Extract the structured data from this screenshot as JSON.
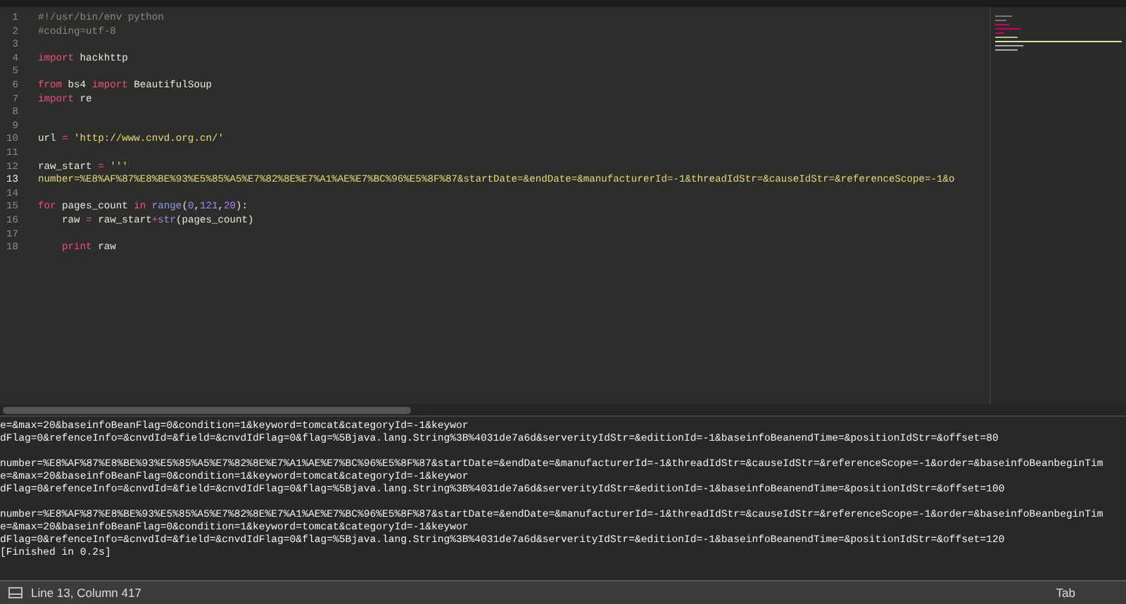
{
  "editor": {
    "lines": [
      {
        "number": "1",
        "current": false,
        "tokens": [
          {
            "kind": "comment",
            "text": "#!/usr/bin/env python"
          }
        ]
      },
      {
        "number": "2",
        "current": false,
        "tokens": [
          {
            "kind": "comment",
            "text": "#coding=utf-8"
          }
        ]
      },
      {
        "number": "3",
        "current": false
      },
      {
        "number": "4",
        "current": false,
        "tokens": [
          {
            "kind": "keyword",
            "text": "import"
          },
          {
            "kind": "plain",
            "text": " hackhttp"
          }
        ]
      },
      {
        "number": "5",
        "current": false
      },
      {
        "number": "6",
        "current": false,
        "tokens": [
          {
            "kind": "keyword",
            "text": "from"
          },
          {
            "kind": "plain",
            "text": " bs4 "
          },
          {
            "kind": "keyword",
            "text": "import"
          },
          {
            "kind": "plain",
            "text": " BeautifulSoup"
          }
        ]
      },
      {
        "number": "7",
        "current": false,
        "tokens": [
          {
            "kind": "keyword",
            "text": "import"
          },
          {
            "kind": "plain",
            "text": " re"
          }
        ]
      },
      {
        "number": "8",
        "current": false
      },
      {
        "number": "9",
        "current": false
      },
      {
        "number": "10",
        "current": false,
        "tokens": [
          {
            "kind": "plain",
            "text": "url "
          },
          {
            "kind": "keyword",
            "text": "="
          },
          {
            "kind": "string",
            "text": " 'http://www.cnvd.org.cn/'"
          }
        ]
      },
      {
        "number": "11",
        "current": false
      },
      {
        "number": "12",
        "current": false,
        "tokens": [
          {
            "kind": "plain",
            "text": "raw_start "
          },
          {
            "kind": "keyword",
            "text": "="
          },
          {
            "kind": "string",
            "text": " '''"
          }
        ]
      },
      {
        "number": "13",
        "current": true,
        "tokens": [
          {
            "kind": "string",
            "text": "number=%E8%AF%87%E8%BE%93%E5%85%A5%E7%82%8E%E7%A1%AE%E7%BC%96%E5%8F%87&startDate=&endDate=&manufacturerId=-1&threadIdStr=&causeIdStr=&referenceScope=-1&o"
          }
        ]
      },
      {
        "number": "14",
        "current": false
      },
      {
        "number": "15",
        "current": false,
        "tokens": [
          {
            "kind": "keyword",
            "text": "for"
          },
          {
            "kind": "plain",
            "text": " pages_count "
          },
          {
            "kind": "keyword",
            "text": "in"
          },
          {
            "kind": "builtin",
            "text": " range"
          },
          {
            "kind": "plain",
            "text": "("
          },
          {
            "kind": "number",
            "text": "0"
          },
          {
            "kind": "plain",
            "text": ","
          },
          {
            "kind": "number",
            "text": "121"
          },
          {
            "kind": "plain",
            "text": ","
          },
          {
            "kind": "number",
            "text": "20"
          },
          {
            "kind": "plain",
            "text": "):"
          }
        ]
      },
      {
        "number": "16",
        "current": false,
        "tokens": [
          {
            "kind": "plain",
            "text": "    raw "
          },
          {
            "kind": "keyword",
            "text": "="
          },
          {
            "kind": "plain",
            "text": " raw_start"
          },
          {
            "kind": "keyword",
            "text": "+"
          },
          {
            "kind": "builtin",
            "text": "str"
          },
          {
            "kind": "plain",
            "text": "(pages_count)"
          }
        ]
      },
      {
        "number": "17",
        "current": false
      },
      {
        "number": "18",
        "current": false,
        "tokens": [
          {
            "kind": "keyword",
            "text": "    print"
          },
          {
            "kind": "plain",
            "text": " raw"
          }
        ]
      }
    ]
  },
  "console": {
    "blocks": [
      [
        "e=&max=20&baseinfoBeanFlag=0&condition=1&keyword=tomcat&categoryId=-1&keywor",
        "dFlag=0&refenceInfo=&cnvdId=&field=&cnvdIdFlag=0&flag=%5Bjava.lang.String%3B%4031de7a6d&serverityIdStr=&editionId=-1&baseinfoBeanendTime=&positionIdStr=&offset=80"
      ],
      [
        "number=%E8%AF%87%E8%BE%93%E5%85%A5%E7%82%8E%E7%A1%AE%E7%BC%96%E5%8F%87&startDate=&endDate=&manufacturerId=-1&threadIdStr=&causeIdStr=&referenceScope=-1&order=&baseinfoBeanbeginTim",
        "e=&max=20&baseinfoBeanFlag=0&condition=1&keyword=tomcat&categoryId=-1&keywor",
        "dFlag=0&refenceInfo=&cnvdId=&field=&cnvdIdFlag=0&flag=%5Bjava.lang.String%3B%4031de7a6d&serverityIdStr=&editionId=-1&baseinfoBeanendTime=&positionIdStr=&offset=100"
      ],
      [
        "number=%E8%AF%87%E8%BE%93%E5%85%A5%E7%82%8E%E7%A1%AE%E7%BC%96%E5%8F%87&startDate=&endDate=&manufacturerId=-1&threadIdStr=&causeIdStr=&referenceScope=-1&order=&baseinfoBeanbeginTim",
        "e=&max=20&baseinfoBeanFlag=0&condition=1&keyword=tomcat&categoryId=-1&keywor",
        "dFlag=0&refenceInfo=&cnvdId=&field=&cnvdIdFlag=0&flag=%5Bjava.lang.String%3B%4031de7a6d&serverityIdStr=&editionId=-1&baseinfoBeanendTime=&positionIdStr=&offset=120",
        "[Finished in 0.2s]"
      ]
    ]
  },
  "status_bar": {
    "position": "Line 13, Column 417",
    "tab_size": "Tab"
  }
}
